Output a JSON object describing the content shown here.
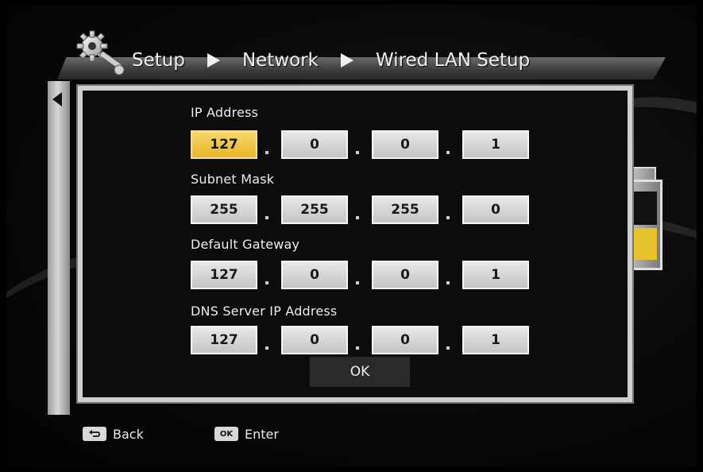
{
  "breadcrumb": [
    "Setup",
    "Network",
    "Wired LAN Setup"
  ],
  "fields": [
    {
      "label": "IP Address",
      "octets": [
        "127",
        "0",
        "0",
        "1"
      ]
    },
    {
      "label": "Subnet Mask",
      "octets": [
        "255",
        "255",
        "255",
        "0"
      ]
    },
    {
      "label": "Default Gateway",
      "octets": [
        "127",
        "0",
        "0",
        "1"
      ]
    },
    {
      "label": "DNS Server IP Address",
      "octets": [
        "127",
        "0",
        "0",
        "1"
      ]
    }
  ],
  "ok_label": "OK",
  "footer": {
    "back_label": "Back",
    "enter_label": "Enter",
    "ok_key_label": "OK"
  },
  "icons": [
    "setup-gear-icon",
    "back-key-icon",
    "ok-key-icon",
    "left-arrow-icon"
  ],
  "colors": {
    "selected": "#e8b62a",
    "accent_right_panel": "#e6c22d"
  }
}
